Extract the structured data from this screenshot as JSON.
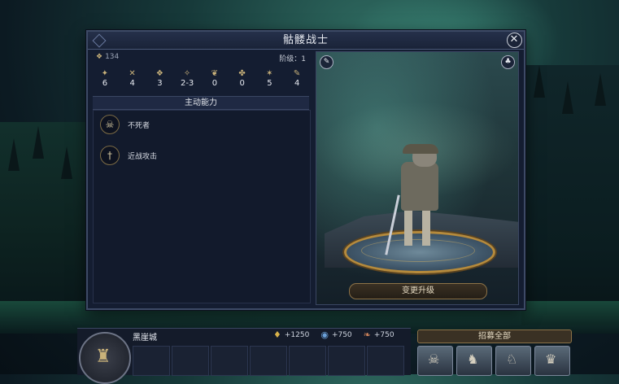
{
  "unit": {
    "title": "骷髅战士",
    "cost": "134",
    "tier_label": "阶级：1"
  },
  "stats": [
    {
      "icon": "attack-icon",
      "glyph": "✦",
      "value": "6"
    },
    {
      "icon": "defense-icon",
      "glyph": "✕",
      "value": "4"
    },
    {
      "icon": "initiative-icon",
      "glyph": "❖",
      "value": "3"
    },
    {
      "icon": "damage-icon",
      "glyph": "✧",
      "value": "2-3"
    },
    {
      "icon": "morale-icon",
      "glyph": "❦",
      "value": "0"
    },
    {
      "icon": "luck-icon",
      "glyph": "✤",
      "value": "0"
    },
    {
      "icon": "speed-icon",
      "glyph": "✶",
      "value": "5"
    },
    {
      "icon": "health-icon",
      "glyph": "✎",
      "value": "4"
    }
  ],
  "abilities_header": "主动能力",
  "abilities": [
    {
      "icon": "skull-icon",
      "glyph": "☠",
      "label": "不死者"
    },
    {
      "icon": "sword-icon",
      "glyph": "†",
      "label": "近战攻击"
    }
  ],
  "upgrade_button": "变更升级",
  "town": {
    "name": "黑崖城"
  },
  "resources": [
    {
      "icon": "gold-icon",
      "value": "+1250"
    },
    {
      "icon": "crystal-icon",
      "value": "+750"
    },
    {
      "icon": "ore-icon",
      "value": "+750"
    }
  ],
  "recruit_all": "招募全部",
  "colors": {
    "panel": "#141d31",
    "border": "#3d4a66",
    "gold_accent": "#c9b27a",
    "button_brown": "#3a3124"
  }
}
